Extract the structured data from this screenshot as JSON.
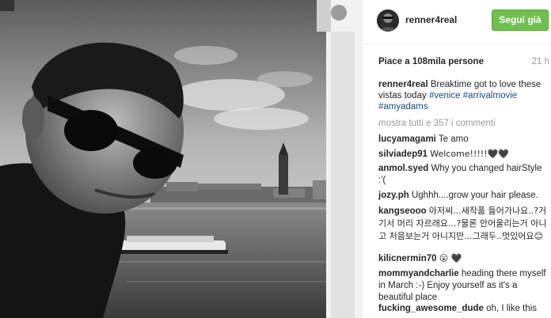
{
  "post": {
    "username": "renner4real",
    "follow_label": "Segui già",
    "likes": "Piace a 108mila persone",
    "timestamp": "21 h",
    "caption": {
      "username": "renner4real",
      "text": "Breaktime got to love these vistas today",
      "hashtags": [
        "#venice",
        "#arrivalmovie",
        "#amyadams"
      ]
    },
    "more_comments": "mostra tutti e 357 i commenti"
  },
  "comments": [
    {
      "user": "lucyamagami",
      "text": "Te amo"
    },
    {
      "user": "silviadep91",
      "text": "Welcome!!!!!🖤🖤"
    },
    {
      "user": "anmol.syed",
      "text": "Why you changed hairStyle :'("
    },
    {
      "user": "jozy.ph",
      "text": "Ughhh....grow your hair please."
    },
    {
      "user": "kangseooo",
      "text": "아저씨...새작품 들어가나요..?거기서 머리 자르래요...?물론 안어울리는거 아니고 처음보는거 아니지만...그래두..멋있어요😊"
    },
    {
      "user": "kilicnermin70",
      "text": "😮 🖤"
    },
    {
      "user": "mommyandcharlie",
      "text": "heading there myself in March :-) Enjoy yourself as it's a beautiful place"
    },
    {
      "user": "fucking_awesome_dude",
      "text": "oh, I like this"
    }
  ],
  "colors": {
    "follow_button": "#70c050",
    "hashtag": "#1b4b7a",
    "muted": "#999999"
  }
}
